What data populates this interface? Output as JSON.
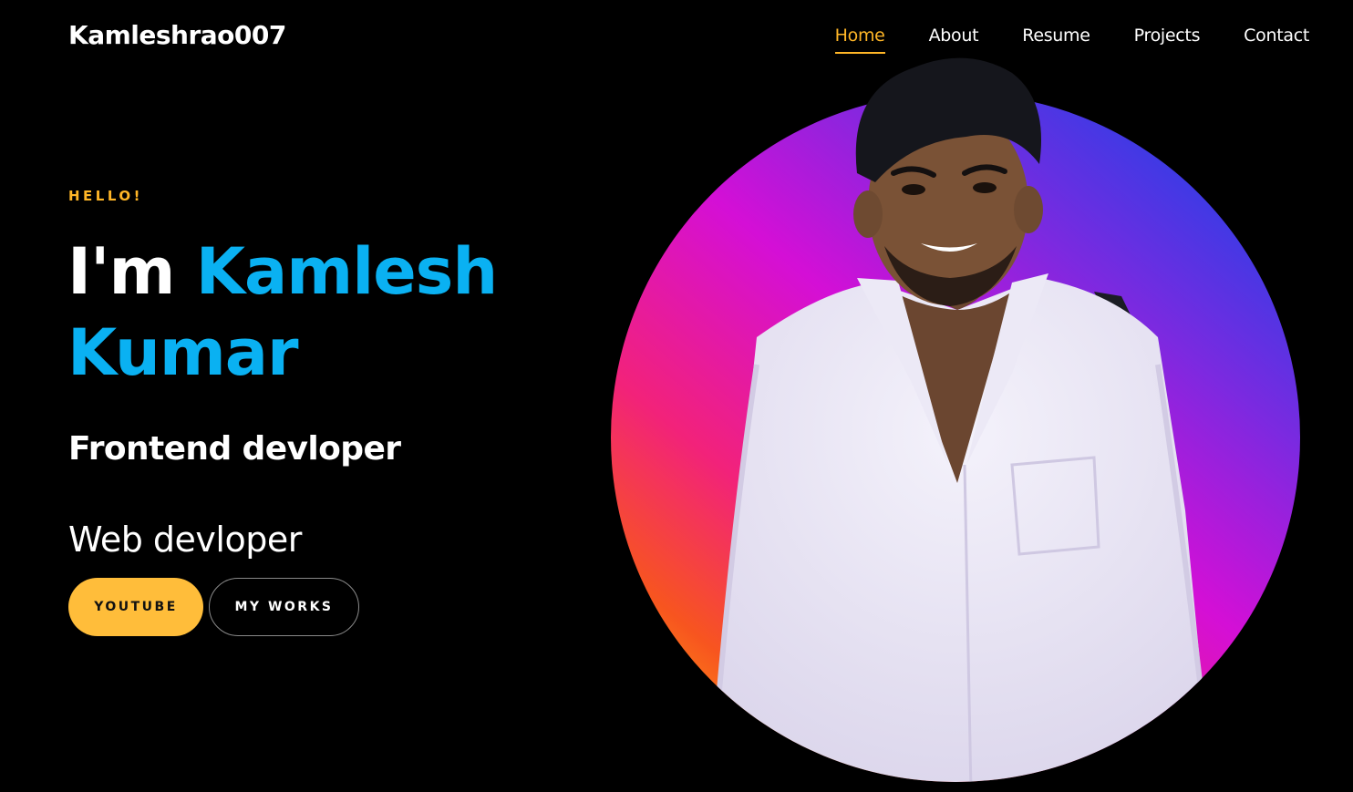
{
  "header": {
    "brand": "Kamleshrao007",
    "nav": [
      {
        "label": "Home",
        "active": true
      },
      {
        "label": "About",
        "active": false
      },
      {
        "label": "Resume",
        "active": false
      },
      {
        "label": "Projects",
        "active": false
      },
      {
        "label": "Contact",
        "active": false
      }
    ]
  },
  "hero": {
    "greeting": "HELLO!",
    "im": "I'm",
    "first_name": "Kamlesh",
    "last_name": "Kumar",
    "subtitle": "Frontend devloper",
    "role": "Web devloper",
    "buttons": {
      "youtube": "YOUTUBE",
      "works": "MY WORKS"
    }
  },
  "colors": {
    "background": "#000000",
    "accent": "#ffb627",
    "name": "#0ab1f2",
    "button_primary": "#ffbd3a"
  },
  "portrait": {
    "subject": "profile-photo"
  }
}
